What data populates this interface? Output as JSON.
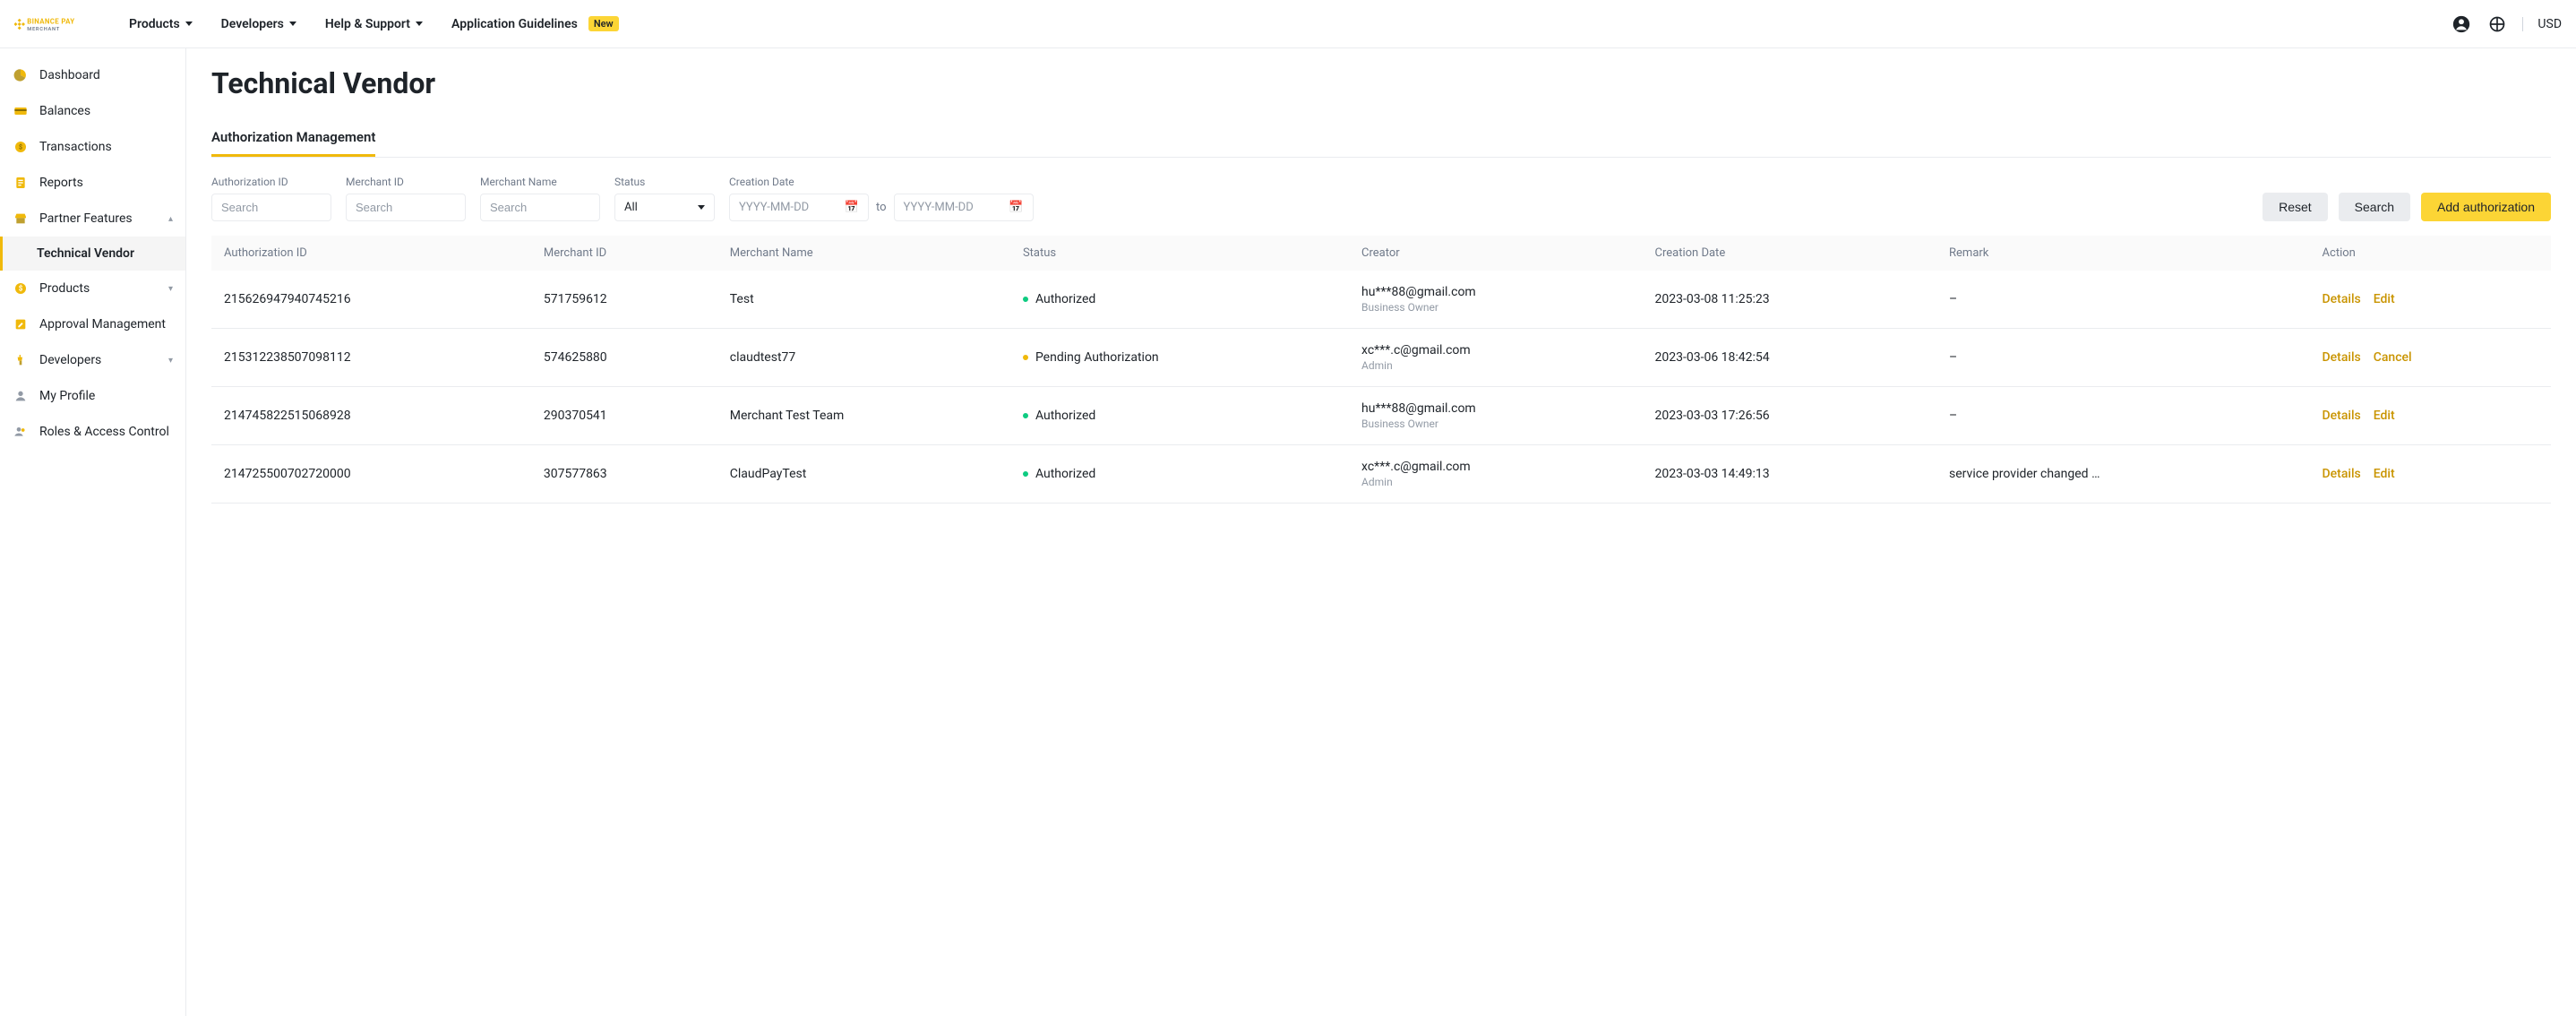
{
  "header": {
    "logo_main": "BINANCE PAY",
    "logo_sub": "MERCHANT",
    "nav": [
      {
        "label": "Products",
        "caret": true
      },
      {
        "label": "Developers",
        "caret": true
      },
      {
        "label": "Help & Support",
        "caret": true
      },
      {
        "label": "Application Guidelines",
        "badge": "New"
      }
    ],
    "currency": "USD"
  },
  "sidebar": {
    "items": [
      {
        "label": "Dashboard",
        "icon": "pie"
      },
      {
        "label": "Balances",
        "icon": "card"
      },
      {
        "label": "Transactions",
        "icon": "coin"
      },
      {
        "label": "Reports",
        "icon": "clipboard"
      },
      {
        "label": "Partner Features",
        "icon": "store",
        "expand": "up"
      },
      {
        "label": "Technical Vendor",
        "sub": true,
        "active": true
      },
      {
        "label": "Products",
        "icon": "dollar",
        "expand": "down"
      },
      {
        "label": "Approval Management",
        "icon": "pencil"
      },
      {
        "label": "Developers",
        "icon": "plug",
        "expand": "down"
      },
      {
        "label": "My Profile",
        "icon": "user"
      },
      {
        "label": "Roles & Access Control",
        "icon": "users"
      }
    ]
  },
  "page": {
    "title": "Technical Vendor",
    "tab": "Authorization Management"
  },
  "filters": {
    "auth_id": {
      "label": "Authorization ID",
      "placeholder": "Search"
    },
    "merchant_id": {
      "label": "Merchant ID",
      "placeholder": "Search"
    },
    "merchant_name": {
      "label": "Merchant Name",
      "placeholder": "Search"
    },
    "status": {
      "label": "Status",
      "value": "All"
    },
    "creation_date": {
      "label": "Creation Date",
      "placeholder_from": "YYYY-MM-DD",
      "to_label": "to",
      "placeholder_to": "YYYY-MM-DD"
    },
    "reset": "Reset",
    "search": "Search",
    "add": "Add authorization"
  },
  "table": {
    "columns": [
      "Authorization ID",
      "Merchant ID",
      "Merchant Name",
      "Status",
      "Creator",
      "Creation Date",
      "Remark",
      "Action"
    ],
    "rows": [
      {
        "auth_id": "215626947940745216",
        "merchant_id": "571759612",
        "merchant_name": "Test",
        "status": "Authorized",
        "status_color": "green",
        "creator_email": "hu***88@gmail.com",
        "creator_role": "Business Owner",
        "date": "2023-03-08 11:25:23",
        "remark": "–",
        "actions": [
          "Details",
          "Edit"
        ]
      },
      {
        "auth_id": "215312238507098112",
        "merchant_id": "574625880",
        "merchant_name": "claudtest77",
        "status": "Pending Authorization",
        "status_color": "yellow",
        "creator_email": "xc***.c@gmail.com",
        "creator_role": "Admin",
        "date": "2023-03-06 18:42:54",
        "remark": "–",
        "actions": [
          "Details",
          "Cancel"
        ]
      },
      {
        "auth_id": "214745822515068928",
        "merchant_id": "290370541",
        "merchant_name": "Merchant Test Team",
        "status": "Authorized",
        "status_color": "green",
        "creator_email": "hu***88@gmail.com",
        "creator_role": "Business Owner",
        "date": "2023-03-03 17:26:56",
        "remark": "–",
        "actions": [
          "Details",
          "Edit"
        ]
      },
      {
        "auth_id": "214725500702720000",
        "merchant_id": "307577863",
        "merchant_name": "ClaudPayTest",
        "status": "Authorized",
        "status_color": "green",
        "creator_email": "xc***.c@gmail.com",
        "creator_role": "Admin",
        "date": "2023-03-03 14:49:13",
        "remark": "service provider changed the …",
        "actions": [
          "Details",
          "Edit"
        ]
      }
    ]
  }
}
